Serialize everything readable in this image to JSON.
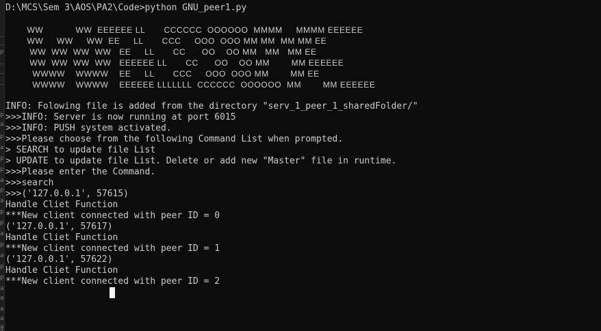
{
  "window": {
    "left_strip_marks": [
      "_",
      "_",
      "p",
      "_p",
      "_p",
      "_p",
      "p",
      "a",
      "p",
      "a",
      "p",
      "p",
      "a",
      "p",
      "a",
      "p",
      "p",
      "a",
      "p",
      "a",
      "p",
      "p",
      "a",
      "a",
      "a",
      "a",
      "a",
      "se"
    ]
  },
  "terminal": {
    "prompt_line": "D:\\MCS\\Sem 3\\AOS\\PA2\\Code>python GNU_peer1.py",
    "banner_lines": [
      "        WW            WW  EEEEEE LL       CCCCCC  OOOOOO  MMMM     MMMM EEEEEE",
      "        WW     WW     WW  EE     LL       CCC     OOO  OOO MM MM  MM MM EE",
      "         WW  WW  WW  WW   EE     LL       CC      OO    OO MM   MM   MM EE",
      "         WW  WW  WW  WW   EEEEEE LL       CC      OO    OO MM        MM EEEEEE",
      "          WWWW    WWWW    EE     LL       CCC     OOO  OOO MM        MM EE",
      "          WWWW    WWWW    EEEEEE LLLLLLL  CCCCCC  OOOOOO  MM        MM EEEEEE"
    ],
    "output_lines": [
      "INFO: Folowing file is added from the directory \"serv_1_peer_1_sharedFolder/\"",
      ">>>INFO: Server is now running at port 6015",
      ">>>INFO: PUSH system activated.",
      ">>>Please choose from the following Command List when prompted.",
      "> SEARCH to update file List",
      "> UPDATE to update file List. Delete or add new \"Master\" file in runtime.",
      ">>>Please enter the Command.",
      ">>>search",
      ">>>('127.0.0.1', 57615)",
      "Handle Cliet Function",
      "***New client connected with peer ID = 0",
      "('127.0.0.1', 57617)",
      "Handle Cliet Function",
      "***New client connected with peer ID = 1",
      "('127.0.0.1', 57622)",
      "Handle Cliet Function",
      "***New client connected with peer ID = 2"
    ]
  }
}
